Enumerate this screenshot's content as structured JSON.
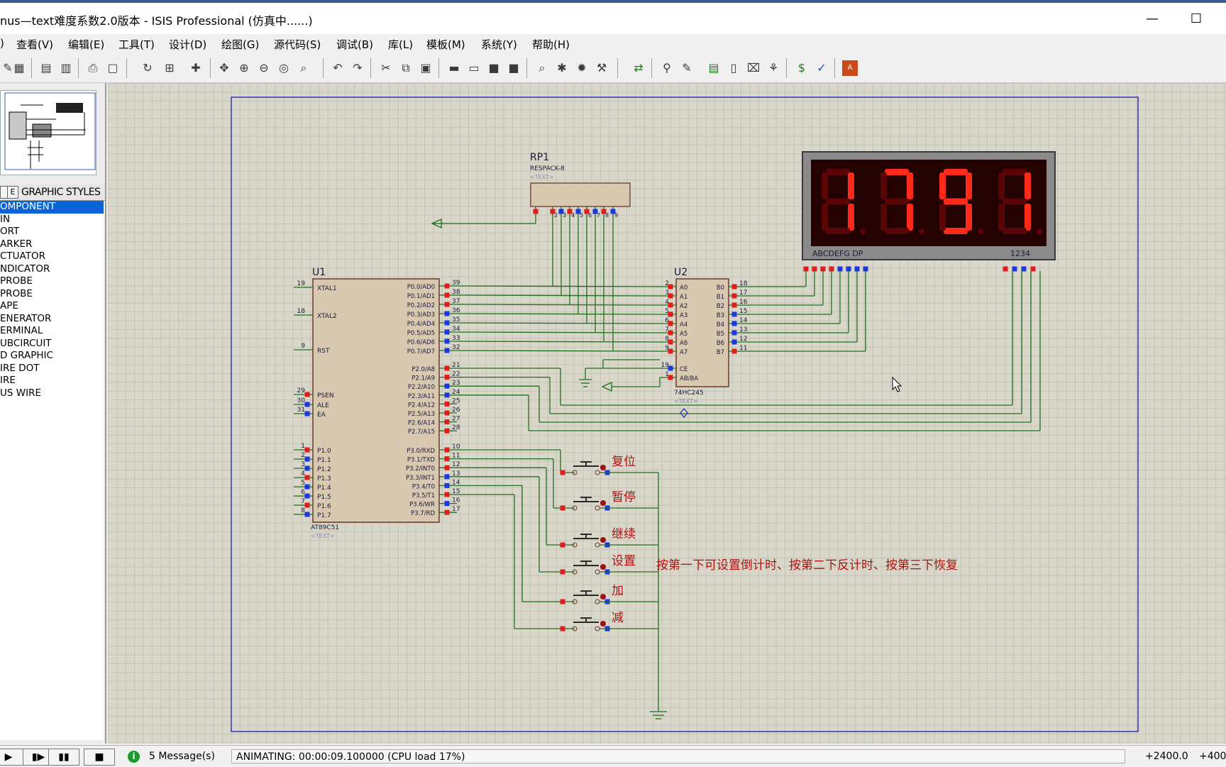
{
  "window": {
    "title": "nus—text难度系数2.0版本 - ISIS Professional (仿真中......)",
    "minimize": "—",
    "maximize": "☐"
  },
  "menu": {
    "file": ")",
    "view": "查看(V)",
    "edit": "编辑(E)",
    "tools": "工具(T)",
    "design": "设计(D)",
    "graph": "绘图(G)",
    "source": "源代码(S)",
    "debug": "调试(B)",
    "library": "库(L)",
    "template": "模板(M)",
    "system": "系统(Y)",
    "help": "帮助(H)"
  },
  "objects": {
    "header_btn1": "",
    "header_btn2": "E",
    "header_label": "GRAPHIC STYLES",
    "items": [
      "OMPONENT",
      "IN",
      "ORT",
      "ARKER",
      "CTUATOR",
      "NDICATOR",
      "PROBE",
      "PROBE",
      "APE",
      "ENERATOR",
      "ERMINAL",
      "UBCIRCUIT",
      "D GRAPHIC",
      "IRE DOT",
      "IRE",
      "US WIRE"
    ]
  },
  "schematic": {
    "u1": {
      "ref": "U1",
      "part": "AT89C51",
      "text": "<TEXT>",
      "left_pins": [
        {
          "n": "19",
          "name": "XTAL1"
        },
        {
          "n": "18",
          "name": "XTAL2"
        },
        {
          "n": "9",
          "name": "RST"
        },
        {
          "n": "29",
          "name": "PSEN"
        },
        {
          "n": "30",
          "name": "ALE"
        },
        {
          "n": "31",
          "name": "EA"
        },
        {
          "n": "1",
          "name": "P1.0"
        },
        {
          "n": "2",
          "name": "P1.1"
        },
        {
          "n": "3",
          "name": "P1.2"
        },
        {
          "n": "4",
          "name": "P1.3"
        },
        {
          "n": "5",
          "name": "P1.4"
        },
        {
          "n": "6",
          "name": "P1.5"
        },
        {
          "n": "7",
          "name": "P1.6"
        },
        {
          "n": "8",
          "name": "P1.7"
        }
      ],
      "right_pins": [
        {
          "n": "39",
          "name": "P0.0/AD0"
        },
        {
          "n": "38",
          "name": "P0.1/AD1"
        },
        {
          "n": "37",
          "name": "P0.2/AD2"
        },
        {
          "n": "36",
          "name": "P0.3/AD3"
        },
        {
          "n": "35",
          "name": "P0.4/AD4"
        },
        {
          "n": "34",
          "name": "P0.5/AD5"
        },
        {
          "n": "33",
          "name": "P0.6/AD6"
        },
        {
          "n": "32",
          "name": "P0.7/AD7"
        },
        {
          "n": "21",
          "name": "P2.0/A8"
        },
        {
          "n": "22",
          "name": "P2.1/A9"
        },
        {
          "n": "23",
          "name": "P2.2/A10"
        },
        {
          "n": "24",
          "name": "P2.3/A11"
        },
        {
          "n": "25",
          "name": "P2.4/A12"
        },
        {
          "n": "26",
          "name": "P2.5/A13"
        },
        {
          "n": "27",
          "name": "P2.6/A14"
        },
        {
          "n": "28",
          "name": "P2.7/A15"
        },
        {
          "n": "10",
          "name": "P3.0/RXD"
        },
        {
          "n": "11",
          "name": "P3.1/TXD"
        },
        {
          "n": "12",
          "name": "P3.2/INT0"
        },
        {
          "n": "13",
          "name": "P3.3/INT1"
        },
        {
          "n": "14",
          "name": "P3.4/T0"
        },
        {
          "n": "15",
          "name": "P3.5/T1"
        },
        {
          "n": "16",
          "name": "P3.6/WR"
        },
        {
          "n": "17",
          "name": "P3.7/RD"
        }
      ]
    },
    "u2": {
      "ref": "U2",
      "part": "74HC245",
      "text": "<TEXT>",
      "left_pins": [
        {
          "n": "2",
          "name": "A0"
        },
        {
          "n": "3",
          "name": "A1"
        },
        {
          "n": "4",
          "name": "A2"
        },
        {
          "n": "5",
          "name": "A3"
        },
        {
          "n": "6",
          "name": "A4"
        },
        {
          "n": "7",
          "name": "A5"
        },
        {
          "n": "8",
          "name": "A6"
        },
        {
          "n": "9",
          "name": "A7"
        },
        {
          "n": "19",
          "name": "CE"
        },
        {
          "n": "1",
          "name": "AB/BA"
        }
      ],
      "right_pins": [
        {
          "n": "18",
          "name": "B0"
        },
        {
          "n": "17",
          "name": "B1"
        },
        {
          "n": "16",
          "name": "B2"
        },
        {
          "n": "15",
          "name": "B3"
        },
        {
          "n": "14",
          "name": "B4"
        },
        {
          "n": "13",
          "name": "B5"
        },
        {
          "n": "12",
          "name": "B6"
        },
        {
          "n": "11",
          "name": "B7"
        }
      ]
    },
    "rp1": {
      "ref": "RP1",
      "part": "RESPACK-8",
      "text": "<TEXT>",
      "pins": [
        "1",
        "2",
        "3",
        "4",
        "5",
        "6",
        "7",
        "8",
        "9"
      ]
    },
    "display": {
      "digits": "1791",
      "seg_label": "ABCDEFG  DP",
      "digit_label": "1234",
      "lit_color": "#ff2a1a",
      "off_color": "#5a0606"
    },
    "buttons": [
      {
        "label": "复位"
      },
      {
        "label": "暂停"
      },
      {
        "label": "继续"
      },
      {
        "label": "设置"
      },
      {
        "label": "加"
      },
      {
        "label": "减"
      }
    ],
    "note": "按第一下可设置倒计时、按第二下反计时、按第三下恢复"
  },
  "status": {
    "play": "▶",
    "step": "▮▶",
    "pause": "▮▮",
    "stop": "■",
    "messages": "5 Message(s)",
    "sim": "ANIMATING: 00:00:09.100000 (CPU load 17%)",
    "coord_x": "+2400.0",
    "coord_y": "+400"
  }
}
